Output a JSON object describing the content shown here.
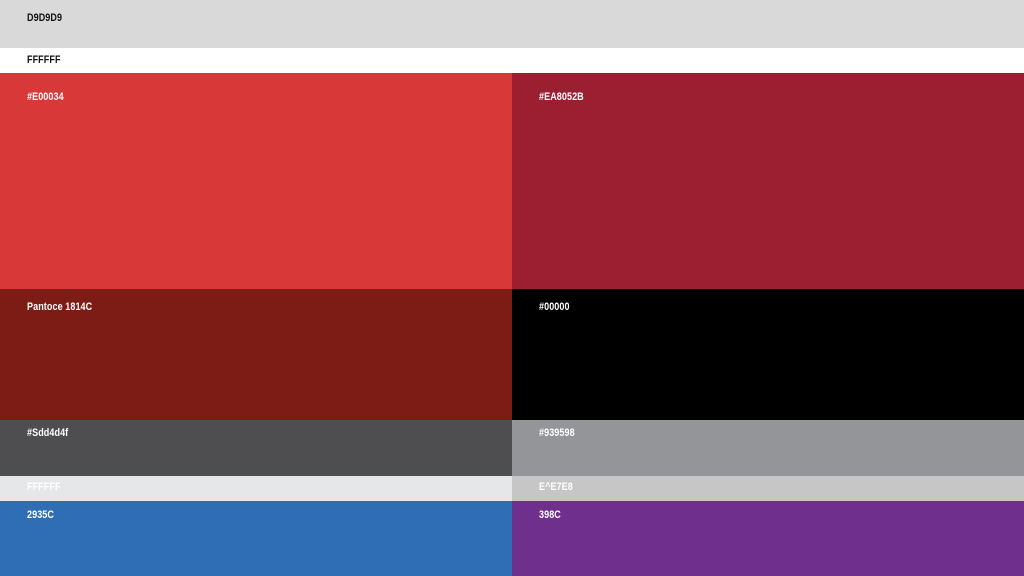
{
  "swatches": {
    "top_gray": {
      "label": "D9D9D9",
      "color": "#d9d9d9",
      "text_color": "#111111"
    },
    "top_white": {
      "label": "FFFFFF",
      "color": "#ffffff",
      "text_color": "#111111"
    },
    "red": {
      "label": "#E00034",
      "color": "#d83838",
      "text_color": "#ffffff"
    },
    "crimson": {
      "label": "#EA8052B",
      "color": "#9b1f30",
      "text_color": "#ffffff"
    },
    "dark_red": {
      "label": "Pantoce 1814C",
      "color": "#7d1c14",
      "text_color": "#ffffff"
    },
    "black": {
      "label": "#00000",
      "color": "#000000",
      "text_color": "#ffffff"
    },
    "dark_gray": {
      "label": "#Sdd4d4f",
      "color": "#4e4e50",
      "text_color": "#ffffff"
    },
    "mid_gray": {
      "label": "#939598",
      "color": "#939598",
      "text_color": "#ffffff"
    },
    "light_white": {
      "label": "FFFFFF",
      "color": "#e6e7e8",
      "text_color": "#ffffff"
    },
    "light_gray": {
      "label": "E^E7E8",
      "color": "#c6c6c6",
      "text_color": "#ffffff"
    },
    "blue": {
      "label": "2935C",
      "color": "#2f6db4",
      "text_color": "#ffffff"
    },
    "purple": {
      "label": "398C",
      "color": "#6e308c",
      "text_color": "#ffffff"
    }
  }
}
